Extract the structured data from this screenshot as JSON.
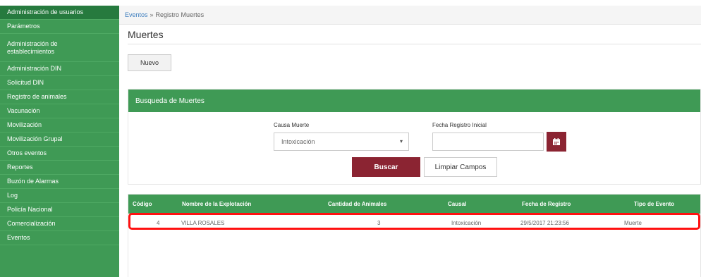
{
  "sidebar": {
    "items": [
      {
        "label": "Administración de usuarios"
      },
      {
        "label": "Parámetros"
      },
      {
        "label": "Administración de establecimientos"
      },
      {
        "label": "Administración DIN"
      },
      {
        "label": "Solicitud DIN"
      },
      {
        "label": "Registro de animales"
      },
      {
        "label": "Vacunación"
      },
      {
        "label": "Movilización"
      },
      {
        "label": "Movilización Grupal"
      },
      {
        "label": "Otros eventos"
      },
      {
        "label": "Reportes"
      },
      {
        "label": "Buzón de Alarmas"
      },
      {
        "label": "Log"
      },
      {
        "label": "Policía Nacional"
      },
      {
        "label": "Comercialización"
      },
      {
        "label": "Eventos"
      }
    ]
  },
  "breadcrumb": {
    "link": "Eventos",
    "separator": "»",
    "current": "Registro Muertes"
  },
  "page": {
    "title": "Muertes",
    "new_button": "Nuevo"
  },
  "search": {
    "title": "Busqueda de Muertes",
    "cause_label": "Causa Muerte",
    "cause_value": "Intoxicación",
    "date_label": "Fecha Registro Inicial",
    "date_value": "",
    "search_button": "Buscar",
    "clear_button": "Limpiar Campos"
  },
  "table": {
    "headers": [
      "Código",
      "Nombre de la Explotación",
      "Cantidad de Animales",
      "Causal",
      "Fecha de Registro",
      "Tipo de Evento"
    ],
    "rows": [
      {
        "codigo": "4",
        "nombre": "VILLA ROSALES",
        "cantidad": "3",
        "causal": "Intoxicación",
        "fecha": "29/5/2017 21:23:56",
        "tipo": "Muerte"
      }
    ]
  },
  "colors": {
    "sidebar_green": "#3f9a55",
    "header_green": "#3f9a55",
    "maroon_button": "#8b2432",
    "highlight_red": "#ff1111"
  },
  "icons": {
    "calendar": "calendar-icon",
    "dropdown": "chevron-down-icon"
  }
}
